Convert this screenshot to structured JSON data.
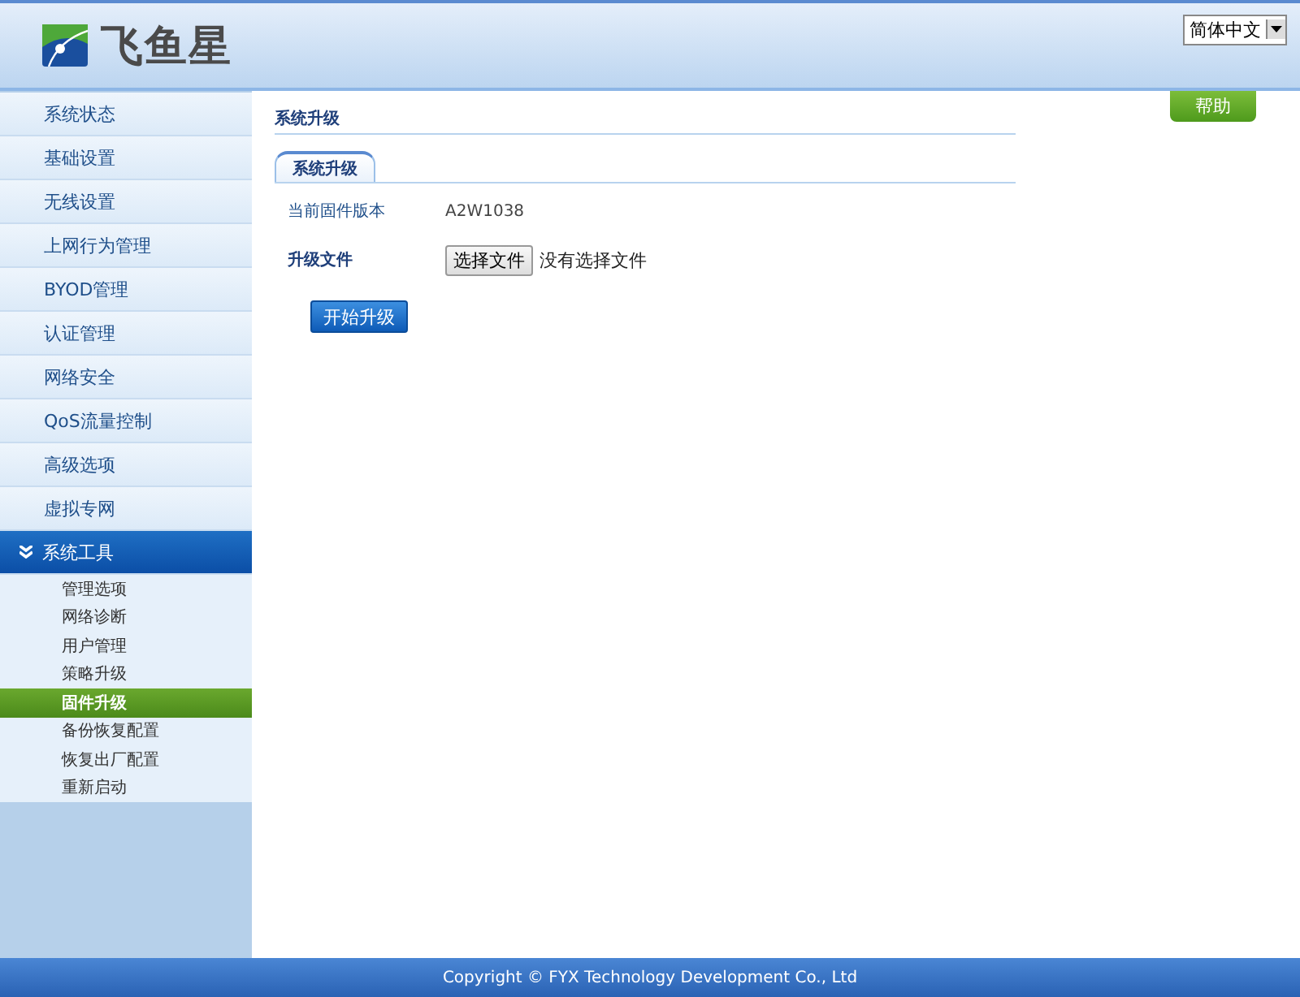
{
  "header": {
    "logo_text": "飞鱼星",
    "language": "简体中文"
  },
  "sidebar": {
    "items": [
      {
        "label": "系统状态",
        "expanded": false
      },
      {
        "label": "基础设置",
        "expanded": false
      },
      {
        "label": "无线设置",
        "expanded": false
      },
      {
        "label": "上网行为管理",
        "expanded": false
      },
      {
        "label": "BYOD管理",
        "expanded": false
      },
      {
        "label": "认证管理",
        "expanded": false
      },
      {
        "label": "网络安全",
        "expanded": false
      },
      {
        "label": "QoS流量控制",
        "expanded": false
      },
      {
        "label": "高级选项",
        "expanded": false
      },
      {
        "label": "虚拟专网",
        "expanded": false
      },
      {
        "label": "系统工具",
        "expanded": true,
        "children": [
          {
            "label": "管理选项",
            "selected": false
          },
          {
            "label": "网络诊断",
            "selected": false
          },
          {
            "label": "用户管理",
            "selected": false
          },
          {
            "label": "策略升级",
            "selected": false
          },
          {
            "label": "固件升级",
            "selected": true
          },
          {
            "label": "备份恢复配置",
            "selected": false
          },
          {
            "label": "恢复出厂配置",
            "selected": false
          },
          {
            "label": "重新启动",
            "selected": false
          }
        ]
      }
    ]
  },
  "main": {
    "title": "系统升级",
    "help_button": "帮助",
    "tabs": [
      {
        "label": "系统升级",
        "selected": true
      }
    ],
    "fields": [
      {
        "kind": "text",
        "label": "当前固件版本",
        "value": "A2W1038"
      },
      {
        "kind": "file",
        "label": "升级文件",
        "button": "选择文件",
        "value": "没有选择文件"
      }
    ],
    "submit_button": "开始升级"
  },
  "footer": {
    "copyright": "Copyright © FYX Technology Development Co., Ltd"
  }
}
